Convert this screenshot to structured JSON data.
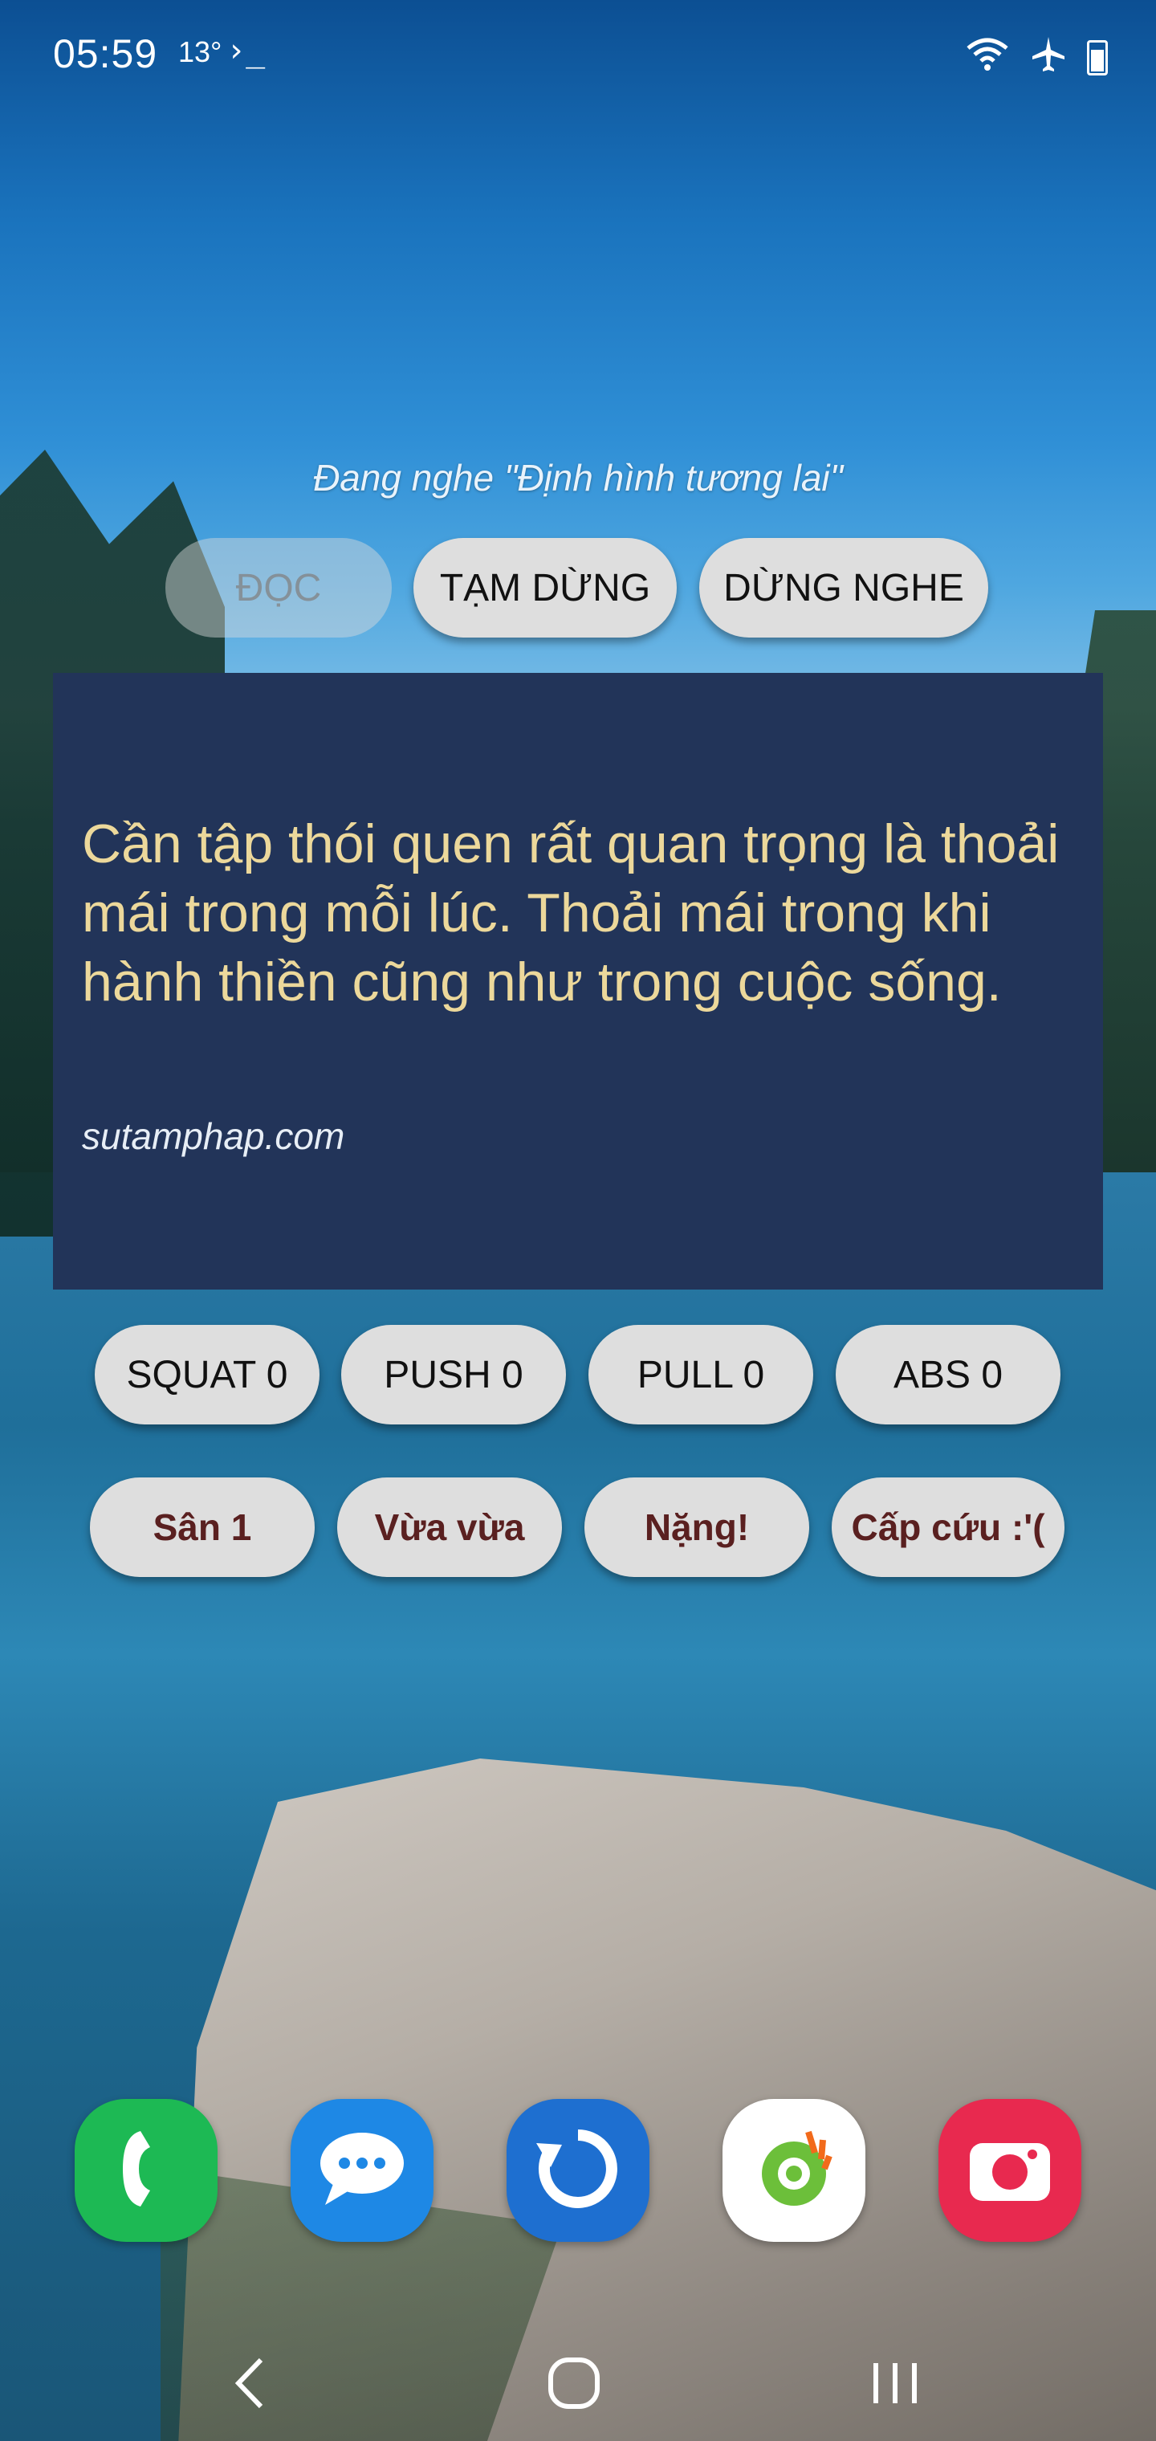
{
  "status_bar": {
    "time": "05:59",
    "temperature": "13°",
    "terminal_symbol": "›_",
    "icons": [
      "wifi-icon",
      "airplane-mode-icon",
      "battery-icon"
    ]
  },
  "widget": {
    "now_playing": "Đang nghe \"Định hình tương lai\"",
    "controls": {
      "read": "ĐỌC",
      "pause": "TẠM DỪNG",
      "stop": "DỪNG NGHE"
    },
    "quote": {
      "text": "Cần tập thói quen rất quan trọng là thoải mái trong mỗi lúc. Thoải mái trong khi hành thiền cũng như trong cuộc sống.",
      "source": "sutamphap.com"
    },
    "exercise_counters": [
      {
        "label": "SQUAT 0"
      },
      {
        "label": "PUSH 0"
      },
      {
        "label": "PULL 0"
      },
      {
        "label": "ABS 0"
      }
    ],
    "levels": [
      {
        "label": "Sân 1"
      },
      {
        "label": "Vừa vừa"
      },
      {
        "label": "Nặng!"
      },
      {
        "label": "Cấp cứu :'("
      }
    ]
  },
  "dock": {
    "apps": [
      {
        "name": "phone-icon",
        "color": "#1db954"
      },
      {
        "name": "messages-icon",
        "color": "#1e88e5"
      },
      {
        "name": "refresh-app-icon",
        "color": "#1e6fd0"
      },
      {
        "name": "browser-app-icon",
        "color": "#ffffff"
      },
      {
        "name": "camera-icon",
        "color": "#e8294f"
      }
    ]
  },
  "navigation": {
    "buttons": [
      "back-icon",
      "home-icon",
      "recents-icon"
    ]
  }
}
